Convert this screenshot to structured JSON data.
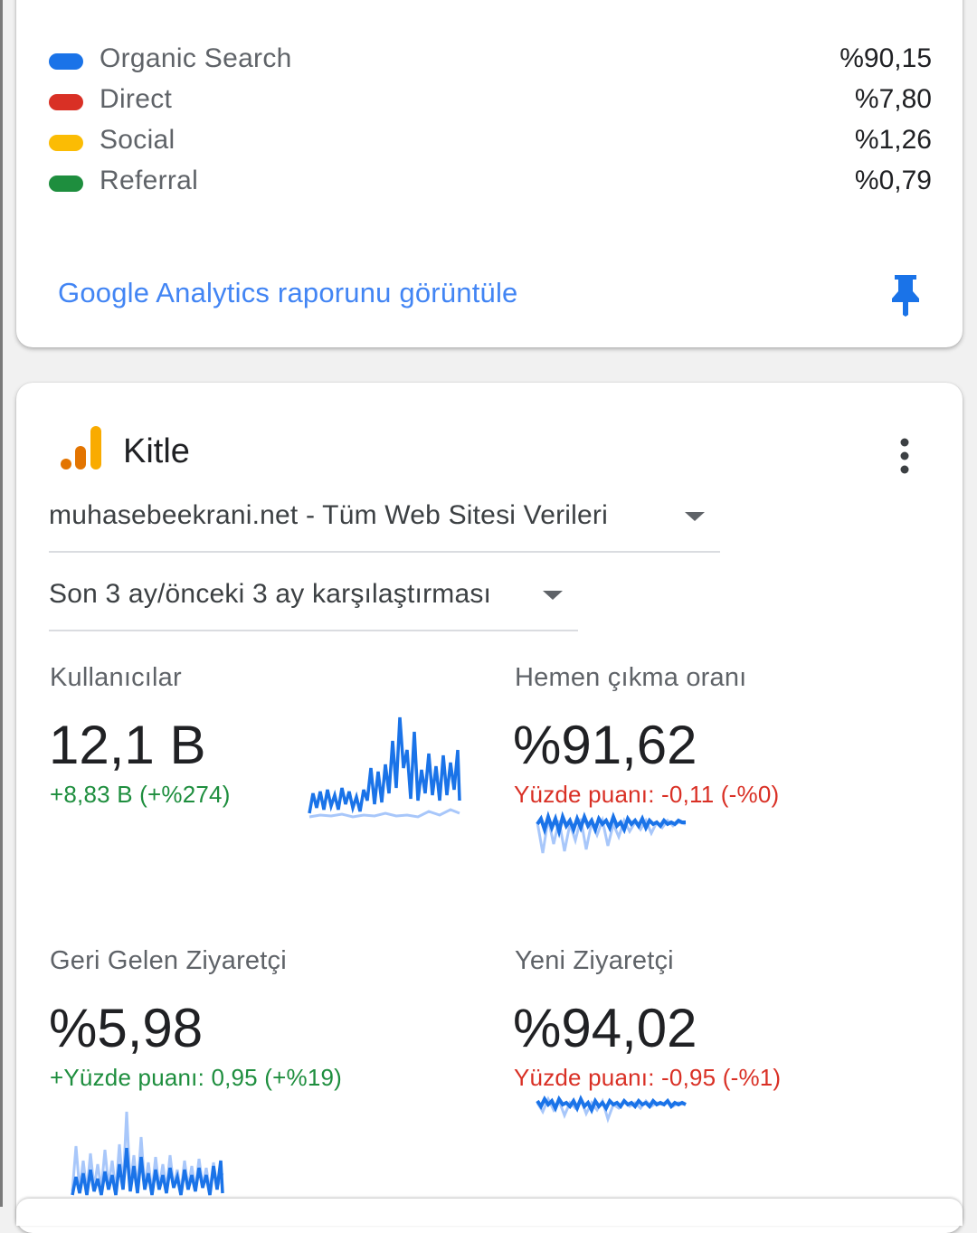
{
  "traffic_card": {
    "legend": [
      {
        "label": "Organic Search",
        "value": "%90,15",
        "color": "#1a73e8"
      },
      {
        "label": "Direct",
        "value": "%7,80",
        "color": "#d93025"
      },
      {
        "label": "Social",
        "value": "%1,26",
        "color": "#fbbc04"
      },
      {
        "label": "Referral",
        "value": "%0,79",
        "color": "#1e8e3e"
      }
    ],
    "report_link": "Google Analytics raporunu görüntüle",
    "pin_icon": "pin-icon"
  },
  "audience_card": {
    "title": "Kitle",
    "icon": "analytics-icon",
    "menu_icon": "more-vert-icon",
    "property_select": "muhasebeekrani.net - Tüm Web Sitesi Verileri",
    "period_select": "Son 3 ay/önceki 3 ay karşılaştırması",
    "metrics": {
      "users": {
        "label": "Kullanıcılar",
        "value": "12,1 B",
        "delta": "+8,83 B (+%274)",
        "trend": "up"
      },
      "bounce": {
        "label": "Hemen çıkma oranı",
        "value": "%91,62",
        "delta": "Yüzde puanı: -0,11 (-%0)",
        "trend": "down"
      },
      "returning": {
        "label": "Geri Gelen Ziyaretçi",
        "value": "%5,98",
        "delta": "+Yüzde puanı: 0,95 (+%19)",
        "trend": "up"
      },
      "new": {
        "label": "Yeni Ziyaretçi",
        "value": "%94,02",
        "delta": "Yüzde puanı: -0,95 (-%1)",
        "trend": "down"
      }
    }
  },
  "colors": {
    "link": "#4285f4",
    "positive": "#1e8e3e",
    "negative": "#d93025",
    "spark_current": "#1a73e8",
    "spark_previous": "#a8c7fa"
  }
}
